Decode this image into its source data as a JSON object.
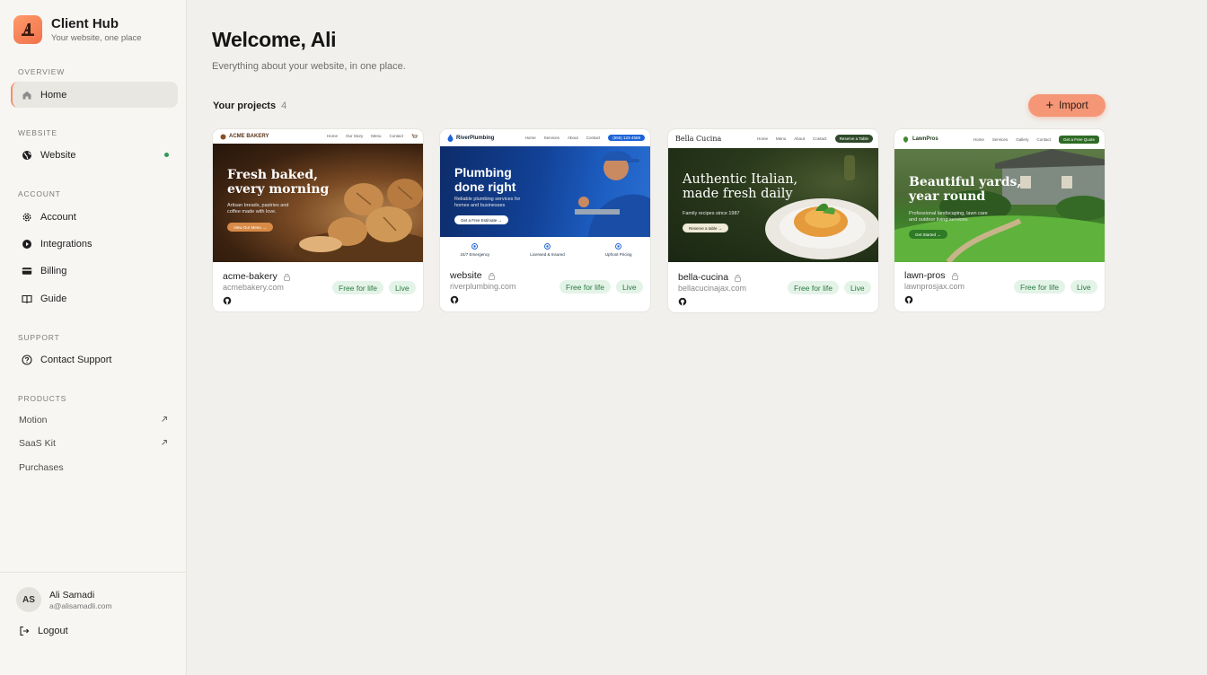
{
  "brand": {
    "title": "Client Hub",
    "subtitle": "Your website, one place"
  },
  "sidebar": {
    "sections": {
      "overview": "OVERVIEW",
      "website": "WEBSITE",
      "account": "ACCOUNT",
      "support": "SUPPORT",
      "products": "PRODUCTS"
    },
    "home": "Home",
    "website": "Website",
    "account": "Account",
    "integrations": "Integrations",
    "billing": "Billing",
    "guide": "Guide",
    "contact_support": "Contact Support",
    "products": [
      {
        "label": "Motion",
        "external": true
      },
      {
        "label": "SaaS Kit",
        "external": true
      },
      {
        "label": "Purchases",
        "external": false
      }
    ],
    "status_color": "#2f9a56"
  },
  "user": {
    "initials": "AS",
    "name": "Ali Samadi",
    "email": "a@alisamadli.com",
    "logout": "Logout"
  },
  "main": {
    "welcome": "Welcome, Ali",
    "subtitle": "Everything about your website, in one place.",
    "projects_label": "Your projects",
    "projects_count": "4",
    "import_label": "Import",
    "accent": "#f59676"
  },
  "projects": [
    {
      "name": "acme-bakery",
      "domain": "acmebakery.com",
      "plan": "Free for life",
      "status": "Live",
      "thumb": {
        "logo": "ACME BAKERY",
        "links": [
          "Home",
          "Our Story",
          "Menu",
          "Contact"
        ],
        "title_1": "Fresh baked,",
        "title_2": "every morning",
        "sub_1": "Artisan breads, pastries and",
        "sub_2": "coffee made with love.",
        "cta": "View Our Menu →"
      }
    },
    {
      "name": "website",
      "domain": "riverplumbing.com",
      "plan": "Free for life",
      "status": "Live",
      "thumb": {
        "logo": "RiverPlumbing",
        "links": [
          "Home",
          "Services",
          "About",
          "Contact"
        ],
        "phone": "(555) 123-4569",
        "title_1": "Plumbing",
        "title_2": "done right",
        "sub_1": "Reliable plumbing services for",
        "sub_2": "homes and businesses",
        "cta": "Get a Free Estimate →",
        "features": [
          "24/7 Emergency",
          "Licensed & Insured",
          "Upfront Pricing"
        ]
      }
    },
    {
      "name": "bella-cucina",
      "domain": "bellacucinajax.com",
      "plan": "Free for life",
      "status": "Live",
      "thumb": {
        "logo": "Bella Cucina",
        "links": [
          "Home",
          "Menu",
          "About",
          "Contact"
        ],
        "nav_cta": "Reserve a Table",
        "title_1": "Authentic Italian,",
        "title_2": "made fresh daily",
        "sub_1": "Family recipes since 1987",
        "cta": "Reserve a table →"
      }
    },
    {
      "name": "lawn-pros",
      "domain": "lawnprosjax.com",
      "plan": "Free for life",
      "status": "Live",
      "thumb": {
        "logo": "LawnPros",
        "links": [
          "Home",
          "Services",
          "Gallery",
          "Contact"
        ],
        "nav_cta": "Get a Free Quote",
        "title_1": "Beautiful yards,",
        "title_2": "year round",
        "sub_1": "Professional landscaping, lawn care",
        "sub_2": "and outdoor living services.",
        "cta": "Get Started →"
      }
    }
  ]
}
